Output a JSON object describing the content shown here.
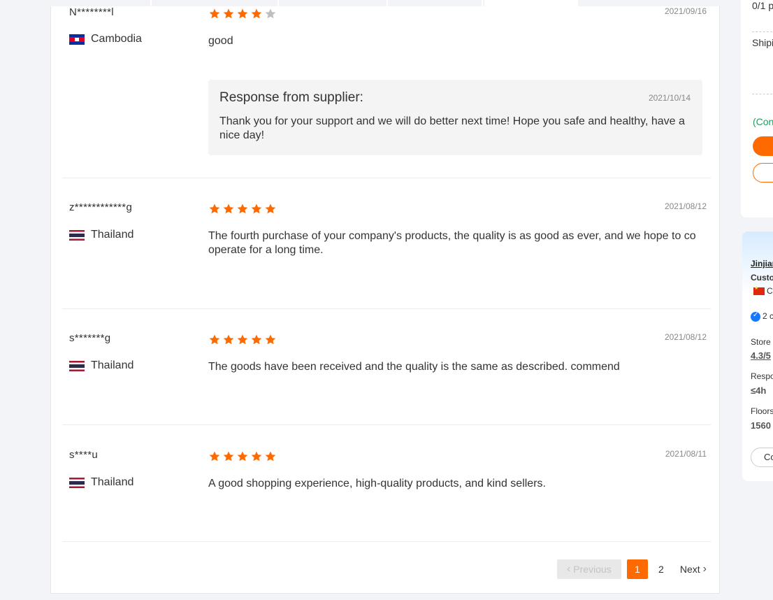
{
  "colors": {
    "accent": "#ff6a00",
    "star": "#ff6a00",
    "star_empty": "#bfbfbf",
    "green": "#1aa260"
  },
  "reviews": [
    {
      "name": "N********l",
      "country": "Cambodia",
      "flag": "cambodia-flag-icon",
      "rating": 4,
      "date": "2021/09/16",
      "text": "good",
      "supplier_response": {
        "title": "Response from supplier:",
        "date": "2021/10/14",
        "text": "Thank you for your support and we will do better next time! Hope you safe and healthy, have a nice day!"
      }
    },
    {
      "name": "z************g",
      "country": "Thailand",
      "flag": "thailand-flag-icon",
      "rating": 5,
      "date": "2021/08/12",
      "text": "The fourth purchase of your company's products, the quality is as good as ever, and we hope to co operate for a long time."
    },
    {
      "name": "s*******g",
      "country": "Thailand",
      "flag": "thailand-flag-icon",
      "rating": 5,
      "date": "2021/08/12",
      "text": "The goods have been received and the quality is the same as described. commend"
    },
    {
      "name": "s****u",
      "country": "Thailand",
      "flag": "thailand-flag-icon",
      "rating": 5,
      "date": "2021/08/11",
      "text": "A good shopping experience, high-quality products, and kind sellers."
    }
  ],
  "pagination": {
    "previous_label": "Previous",
    "pages": [
      "1",
      "2"
    ],
    "current_page": "1",
    "next_label": "Next"
  },
  "side_top": {
    "line1": "0/1 p",
    "line2": "Shipi",
    "green_text": "(Con"
  },
  "side_bottom": {
    "company": "Jinjian",
    "type": "Custo",
    "country": "Ch",
    "years": "2 c",
    "store_label": "Store",
    "store_value": "4.3/5",
    "response_label": "Respo",
    "response_value": "≤4h",
    "floor_label": "Floors",
    "floor_value": "1560",
    "button_label": "Co"
  }
}
